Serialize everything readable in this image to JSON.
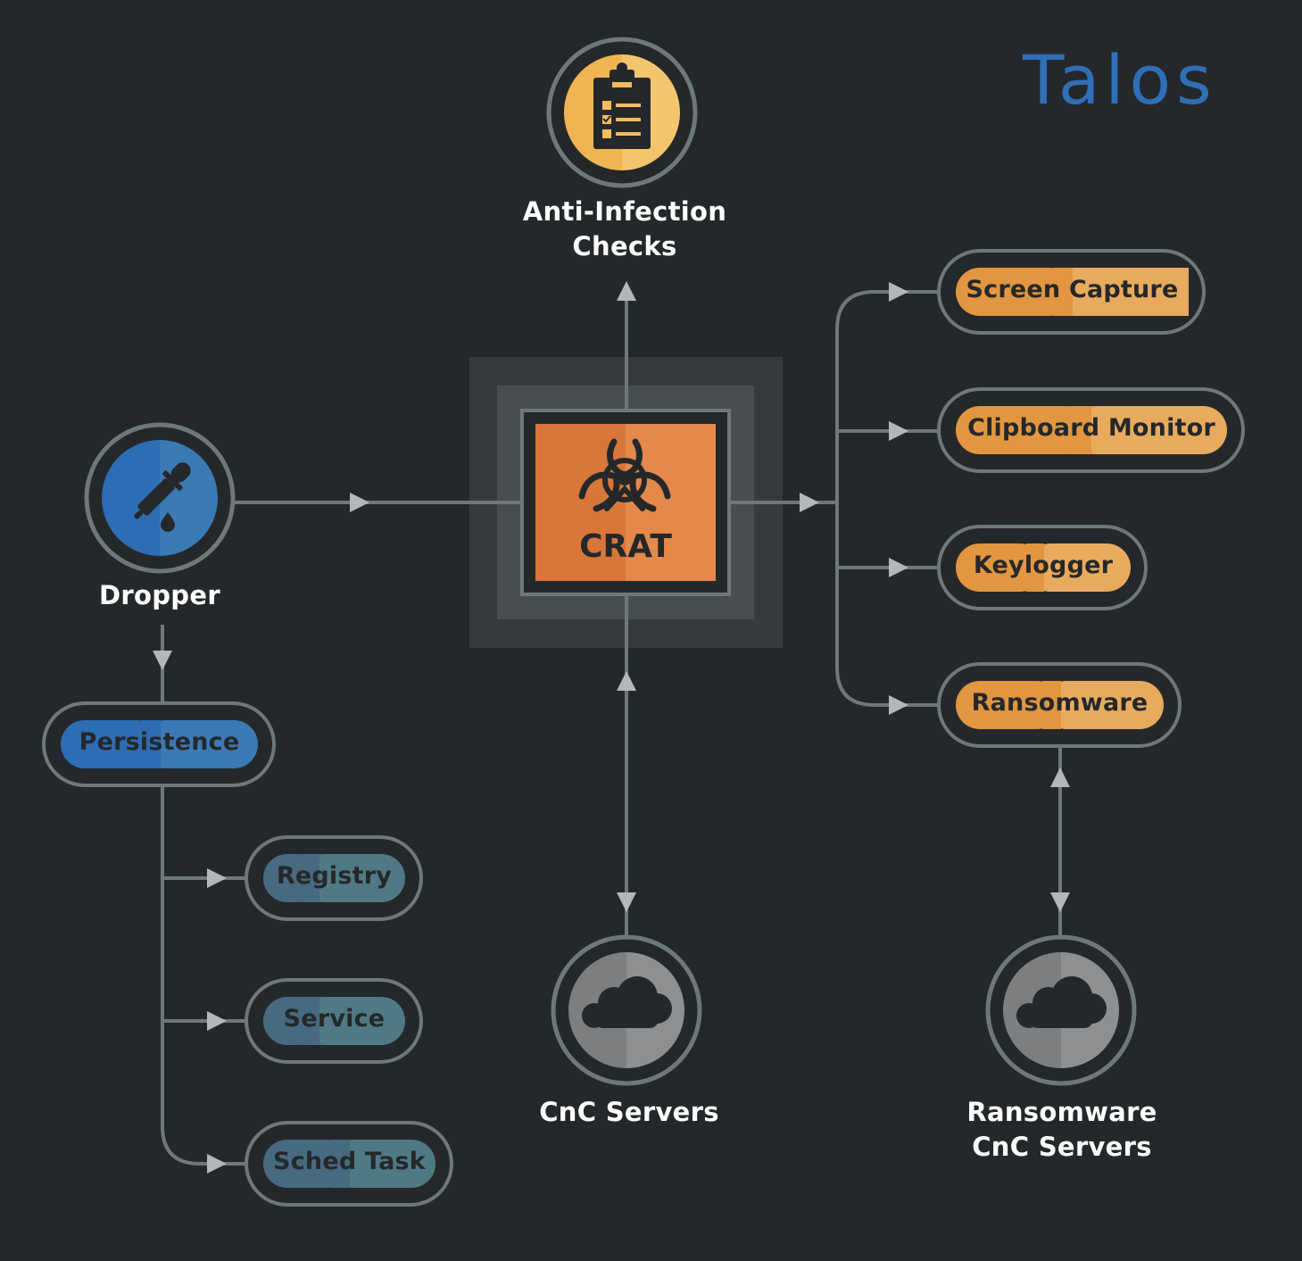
{
  "brand": {
    "logo_text": "Talos",
    "color": "#2f6fb7"
  },
  "colors": {
    "background": "#25282a",
    "line": "#6f7878",
    "arrow": "#b4b6b9",
    "orange": "#e08d3a",
    "orange_light": "#e8a95c",
    "blue": "#2d6db4",
    "blue_light": "#3a7ab5",
    "teal": "#466a80",
    "teal_light": "#4f7a85",
    "gray_node": "#7d7e80",
    "gray_node_light": "#8e8f91",
    "yellow": "#f0b552",
    "yellow_light": "#f3c56d",
    "crat": "#d9763a",
    "crat_light": "#e4894b"
  },
  "center": {
    "label": "CRAT",
    "icon": "biohazard-icon"
  },
  "nodes": {
    "anti_infection": {
      "line1": "Anti-Infection",
      "line2": "Checks",
      "icon": "clipboard-checklist-icon"
    },
    "dropper": {
      "label": "Dropper",
      "icon": "eyedropper-icon"
    },
    "cnc": {
      "label": "CnC Servers",
      "icon": "cloud-icon"
    },
    "ransom_cnc": {
      "line1": "Ransomware",
      "line2": "CnC Servers",
      "icon": "cloud-icon"
    }
  },
  "modules": [
    {
      "label": "Screen Capture"
    },
    {
      "label": "Clipboard Monitor"
    },
    {
      "label": "Keylogger"
    },
    {
      "label": "Ransomware"
    }
  ],
  "persistence": {
    "label": "Persistence",
    "methods": [
      {
        "label": "Registry"
      },
      {
        "label": "Service"
      },
      {
        "label": "Sched Task"
      }
    ]
  }
}
